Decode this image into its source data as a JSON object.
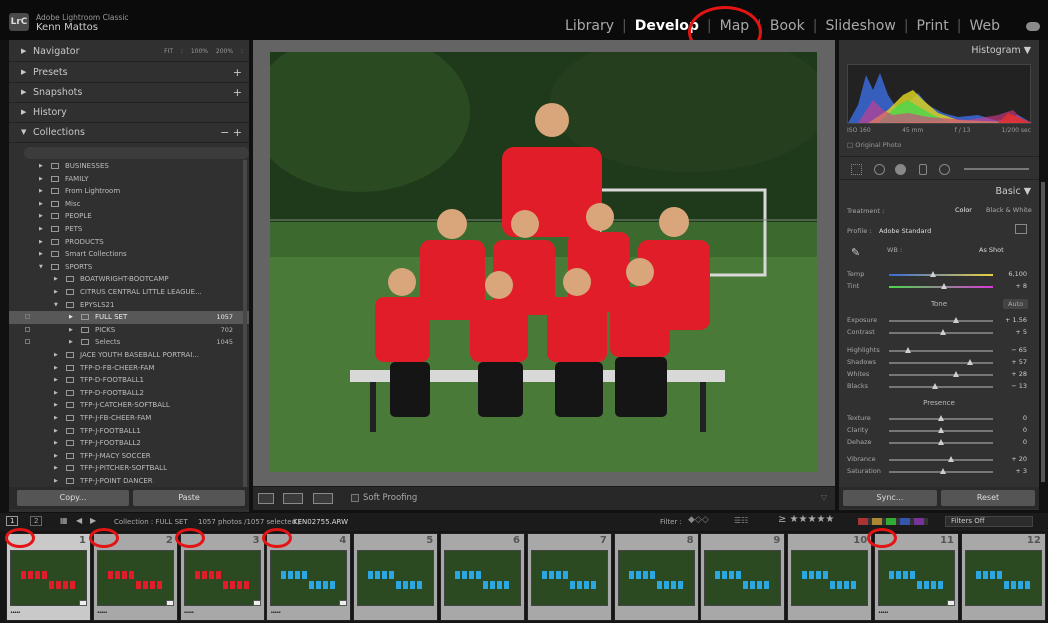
{
  "app": {
    "logo": "LrC",
    "name": "Adobe Lightroom Classic",
    "user": "Kenn Mattos"
  },
  "modules": [
    {
      "label": "Library",
      "active": false
    },
    {
      "label": "Develop",
      "active": true
    },
    {
      "label": "Map",
      "active": false
    },
    {
      "label": "Book",
      "active": false
    },
    {
      "label": "Slideshow",
      "active": false
    },
    {
      "label": "Print",
      "active": false
    },
    {
      "label": "Web",
      "active": false
    }
  ],
  "left_panel": {
    "navigator": {
      "label": "Navigator",
      "options": "FIT : 100% 200% :"
    },
    "presets": "Presets",
    "snapshots": "Snapshots",
    "history": "History",
    "collections": "Collections",
    "collection_items": [
      {
        "name": "BUSINESSES",
        "depth": 1
      },
      {
        "name": "FAMILY",
        "depth": 1
      },
      {
        "name": "From Lightroom",
        "depth": 1
      },
      {
        "name": "Misc",
        "depth": 1
      },
      {
        "name": "PEOPLE",
        "depth": 1
      },
      {
        "name": "PETS",
        "depth": 1
      },
      {
        "name": "PRODUCTS",
        "depth": 1
      },
      {
        "name": "Smart Collections",
        "depth": 1
      },
      {
        "name": "SPORTS",
        "depth": 1,
        "open": true
      },
      {
        "name": "BOATWRIGHT-BOOTCAMP",
        "depth": 2
      },
      {
        "name": "CITRUS CENTRAL LITTLE LEAGUE...",
        "depth": 2
      },
      {
        "name": "EPYSLS21",
        "depth": 2,
        "open": true
      },
      {
        "name": "FULL SET",
        "depth": 3,
        "count": "1057",
        "selected": true
      },
      {
        "name": "PICKS",
        "depth": 3,
        "count": "702"
      },
      {
        "name": "Selects",
        "depth": 3,
        "count": "1045"
      },
      {
        "name": "JACE YOUTH BASEBALL PORTRAI...",
        "depth": 2
      },
      {
        "name": "TFP-D-FB-CHEER-FAM",
        "depth": 2
      },
      {
        "name": "TFP-D-FOOTBALL1",
        "depth": 2
      },
      {
        "name": "TFP-D-FOOTBALL2",
        "depth": 2
      },
      {
        "name": "TFP-J-CATCHER-SOFTBALL",
        "depth": 2
      },
      {
        "name": "TFP-J-FB-CHEER-FAM",
        "depth": 2
      },
      {
        "name": "TFP-J-FOOTBALL1",
        "depth": 2
      },
      {
        "name": "TFP-J-FOOTBALL2",
        "depth": 2
      },
      {
        "name": "TFP-J-MACY SOCCER",
        "depth": 2
      },
      {
        "name": "TFP-J-PITCHER-SOFTBALL",
        "depth": 2
      },
      {
        "name": "TFP-J-POINT DANCER",
        "depth": 2
      }
    ],
    "copy_button": "Copy...",
    "paste_button": "Paste"
  },
  "toolbar": {
    "soft_proofing": "Soft Proofing"
  },
  "right_panel": {
    "histogram_title": "Histogram",
    "iso": "ISO 160",
    "focal": "45 mm",
    "aperture": "f / 13",
    "shutter": "1/200 sec",
    "original_photo": "Original Photo",
    "basic_title": "Basic",
    "treatment_label": "Treatment :",
    "treatment_color": "Color",
    "treatment_bw": "Black & White",
    "profile_label": "Profile :",
    "profile_value": "Adobe Standard",
    "wb_label": "WB :",
    "wb_value": "As Shot",
    "tone_label": "Tone",
    "auto_button": "Auto",
    "presence_label": "Presence",
    "sliders": [
      {
        "name": "Temp",
        "value": "6,100",
        "pos": 0.42
      },
      {
        "name": "Tint",
        "value": "+ 8",
        "pos": 0.53
      },
      {
        "name": "Exposure",
        "value": "+ 1.56",
        "pos": 0.64
      },
      {
        "name": "Contrast",
        "value": "+ 5",
        "pos": 0.52
      },
      {
        "name": "Highlights",
        "value": "− 65",
        "pos": 0.18
      },
      {
        "name": "Shadows",
        "value": "+ 57",
        "pos": 0.78
      },
      {
        "name": "Whites",
        "value": "+ 28",
        "pos": 0.64
      },
      {
        "name": "Blacks",
        "value": "− 13",
        "pos": 0.44
      },
      {
        "name": "Texture",
        "value": "0",
        "pos": 0.5
      },
      {
        "name": "Clarity",
        "value": "0",
        "pos": 0.5
      },
      {
        "name": "Dehaze",
        "value": "0",
        "pos": 0.5
      },
      {
        "name": "Vibrance",
        "value": "+ 20",
        "pos": 0.6
      },
      {
        "name": "Saturation",
        "value": "+ 3",
        "pos": 0.52
      }
    ],
    "sync_button": "Sync...",
    "reset_button": "Reset"
  },
  "filmstrip_bar": {
    "view1": "1",
    "view2": "2",
    "source": "Collection : FULL SET",
    "count": "1057 photos /1057 selected /",
    "filename": "KEN02755.ARW",
    "filter_label": "Filter :",
    "filters_off": "Filters Off"
  },
  "filmstrip": [
    {
      "num": "1",
      "stars": "•••••",
      "jersey": "#e11d2a",
      "selected": true
    },
    {
      "num": "2",
      "stars": "•••••",
      "jersey": "#e11d2a",
      "selected": false
    },
    {
      "num": "3",
      "stars": "•••••",
      "jersey": "#e11d2a",
      "selected": false
    },
    {
      "num": "4",
      "stars": "•••••",
      "jersey": "#2aa6e0",
      "selected": false
    },
    {
      "num": "5",
      "stars": "",
      "jersey": "#2aa6e0",
      "selected": false
    },
    {
      "num": "6",
      "stars": "",
      "jersey": "#2aa6e0",
      "selected": false
    },
    {
      "num": "7",
      "stars": "",
      "jersey": "#2aa6e0",
      "selected": false
    },
    {
      "num": "8",
      "stars": "",
      "jersey": "#2aa6e0",
      "selected": false
    },
    {
      "num": "9",
      "stars": "",
      "jersey": "#2aa6e0",
      "selected": false
    },
    {
      "num": "10",
      "stars": "",
      "jersey": "#2aa6e0",
      "selected": false
    },
    {
      "num": "11",
      "stars": "•••••",
      "jersey": "#2aa6e0",
      "selected": false
    },
    {
      "num": "12",
      "stars": "",
      "jersey": "#2aa6e0",
      "selected": false
    }
  ],
  "colors": {
    "accent_ring": "#e51414",
    "jersey_red": "#e11d2a",
    "field_green": "#3c6a2e"
  }
}
